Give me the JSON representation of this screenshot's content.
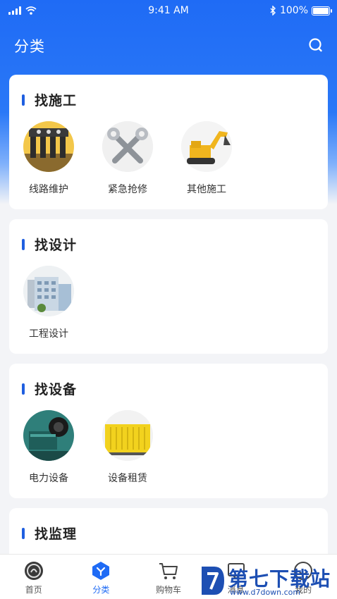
{
  "status_bar": {
    "time": "9:41 AM",
    "battery": "100%"
  },
  "header": {
    "title": "分类"
  },
  "sections": [
    {
      "title": "找施工",
      "items": [
        {
          "label": "线路维护",
          "icon": "electrical-terminal-icon"
        },
        {
          "label": "紧急抢修",
          "icon": "wrench-icon"
        },
        {
          "label": "其他施工",
          "icon": "excavator-icon"
        }
      ]
    },
    {
      "title": "找设计",
      "items": [
        {
          "label": "工程设计",
          "icon": "building-icon"
        }
      ]
    },
    {
      "title": "找设备",
      "items": [
        {
          "label": "电力设备",
          "icon": "generator-icon"
        },
        {
          "label": "设备租赁",
          "icon": "container-generator-icon"
        }
      ]
    },
    {
      "title": "找监理",
      "items": []
    }
  ],
  "tab_bar": {
    "items": [
      {
        "label": "首页",
        "icon": "home-logo-icon"
      },
      {
        "label": "分类",
        "icon": "category-icon",
        "active": true
      },
      {
        "label": "购物车",
        "icon": "cart-icon"
      },
      {
        "label": "消息",
        "icon": "message-icon"
      },
      {
        "label": "我的",
        "icon": "profile-icon"
      }
    ]
  },
  "watermark": {
    "name": "第七下载站",
    "url": "www.d7down.com"
  },
  "colors": {
    "primary": "#1f6bf5",
    "section_bar": "#1f5fe0",
    "background": "#f3f4f7"
  }
}
